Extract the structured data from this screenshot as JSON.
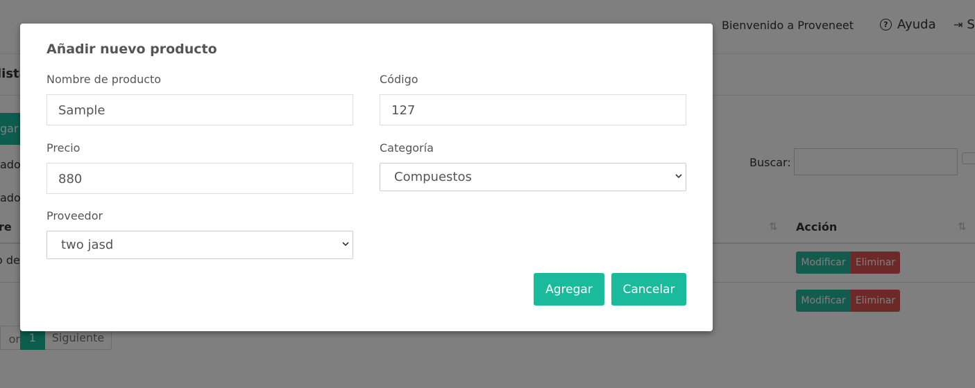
{
  "header": {
    "welcome": "Bienvenido a Proveneet",
    "help_label": "Ayuda",
    "logout_label": "S"
  },
  "background": {
    "panel_title": "lista",
    "add_button": "gar",
    "show_text": "ado",
    "filter_text": "ado",
    "search_label": "Buscar:",
    "columns": [
      "re",
      "Acción"
    ],
    "rows": [
      {
        "name": "o de",
        "modify": "Modificar",
        "delete": "Eliminar"
      },
      {
        "name": "",
        "modify": "Modificar",
        "delete": "Eliminar"
      }
    ],
    "pager": {
      "prev": "or",
      "page": "1",
      "next": "Siguiente"
    }
  },
  "modal": {
    "title": "Añadir nuevo producto",
    "fields": {
      "name": {
        "label": "Nombre de producto",
        "value": "Sample"
      },
      "code": {
        "label": "Código",
        "value": "127"
      },
      "price": {
        "label": "Precio",
        "value": "880"
      },
      "category": {
        "label": "Categoría",
        "value": "Compuestos"
      },
      "supplier": {
        "label": "Proveedor",
        "value": "two jasd"
      }
    },
    "buttons": {
      "add": "Agregar",
      "cancel": "Cancelar"
    }
  },
  "colors": {
    "primary": "#1abb9c",
    "modify": "#26b99a",
    "delete": "#d9534f"
  }
}
